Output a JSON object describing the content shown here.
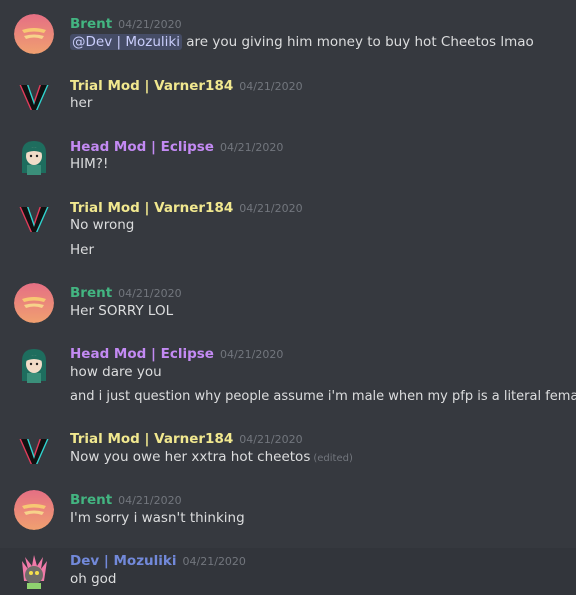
{
  "colors": {
    "brent": "#43b581",
    "trial_mod": "#f1e88f",
    "head_mod": "#c38af3",
    "dev": "#7289da"
  },
  "messages": [
    {
      "author": "Brent",
      "timestamp": "04/21/2020",
      "mention": "@Dev | Mozuliki",
      "lines": [
        "are you giving him money to buy hot Cheetos lmao"
      ]
    },
    {
      "author": "Trial Mod | Varner184",
      "timestamp": "04/21/2020",
      "lines": [
        "her"
      ]
    },
    {
      "author": "Head Mod | Eclipse",
      "timestamp": "04/21/2020",
      "lines": [
        "HIM?!"
      ]
    },
    {
      "author": "Trial Mod | Varner184",
      "timestamp": "04/21/2020",
      "lines": [
        "No wrong",
        "Her"
      ]
    },
    {
      "author": "Brent",
      "timestamp": "04/21/2020",
      "lines": [
        "Her SORRY LOL"
      ]
    },
    {
      "author": "Head Mod | Eclipse",
      "timestamp": "04/21/2020",
      "lines": [
        "how dare you",
        "and i just question why people assume i'm male when my pfp is a literal female"
      ]
    },
    {
      "author": "Trial Mod | Varner184",
      "timestamp": "04/21/2020",
      "lines": [
        "Now you owe her xxtra hot cheetos"
      ],
      "edited": "(edited)"
    },
    {
      "author": "Brent",
      "timestamp": "04/21/2020",
      "lines": [
        "I'm sorry i wasn't thinking"
      ]
    },
    {
      "author": "Dev | Mozuliki",
      "timestamp": "04/21/2020",
      "lines": [
        "oh god"
      ]
    }
  ]
}
